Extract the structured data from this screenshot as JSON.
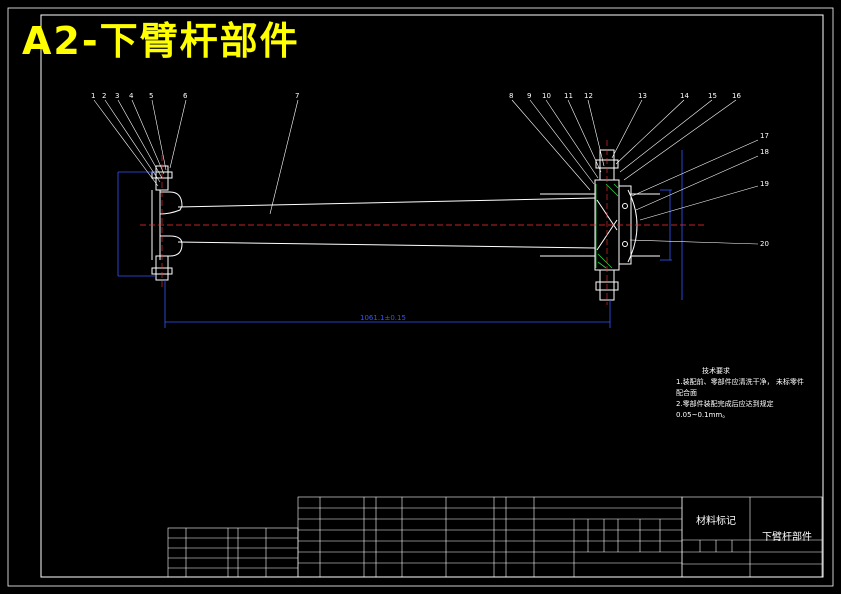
{
  "title_text": "A2-下臂杆部件",
  "part_name": "下臂杆部件",
  "material_label": "材料标记",
  "balloons": [
    "1",
    "2",
    "3",
    "4",
    "5",
    "6",
    "7",
    "8",
    "9",
    "10",
    "11",
    "12",
    "13",
    "14",
    "15",
    "16",
    "17",
    "18",
    "19",
    "20"
  ],
  "dimensions": {
    "overall_length": "1061.1±0.15"
  },
  "tech_notes": {
    "heading": "技术要求",
    "lines": [
      "1.装配前、零部件应清洗干净，  未标零件",
      "    配合面",
      "2.零部件装配完成后应达到规定",
      "    0.05~0.1mm。"
    ]
  },
  "colors": {
    "title": "#ffff00",
    "outline": "#ffffff",
    "centerline": "#ff3030",
    "dimension": "#3355ff",
    "hatch": "#2fd14a",
    "leader": "#ffffff"
  }
}
